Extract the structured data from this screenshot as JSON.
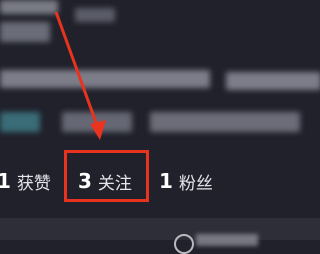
{
  "profile": {
    "stats": [
      {
        "count": "1",
        "label": "获赞"
      },
      {
        "count": "3",
        "label": "关注"
      },
      {
        "count": "1",
        "label": "粉丝"
      }
    ]
  },
  "annotation": {
    "color": "#e8331f"
  },
  "colors": {
    "background": "#20212b",
    "bottom_bar": "#2d2e38"
  },
  "icons": {
    "bottom_bar_icon": "add-friend-icon"
  }
}
